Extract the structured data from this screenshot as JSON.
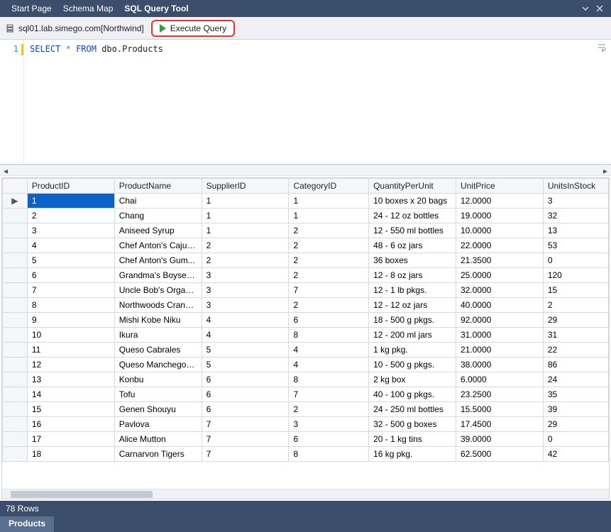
{
  "tabs": {
    "items": [
      "Start Page",
      "Schema Map",
      "SQL Query Tool"
    ],
    "active_index": 2
  },
  "toolbar": {
    "connection": "sql01.lab.simego.com[Northwind]",
    "execute_label": "Execute Query"
  },
  "editor": {
    "line_number": "1",
    "sql_select": "SELECT",
    "sql_star": "*",
    "sql_from": "FROM",
    "sql_ident": "dbo.Products"
  },
  "grid": {
    "columns": [
      "ProductID",
      "ProductName",
      "SupplierID",
      "CategoryID",
      "QuantityPerUnit",
      "UnitPrice",
      "UnitsInStock"
    ],
    "selected_row": 0,
    "rows": [
      {
        "ProductID": "1",
        "ProductName": "Chai",
        "SupplierID": "1",
        "CategoryID": "1",
        "QuantityPerUnit": "10 boxes x 20 bags",
        "UnitPrice": "12.0000",
        "UnitsInStock": "3"
      },
      {
        "ProductID": "2",
        "ProductName": "Chang",
        "SupplierID": "1",
        "CategoryID": "1",
        "QuantityPerUnit": "24 - 12 oz bottles",
        "UnitPrice": "19.0000",
        "UnitsInStock": "32"
      },
      {
        "ProductID": "3",
        "ProductName": "Aniseed Syrup",
        "SupplierID": "1",
        "CategoryID": "2",
        "QuantityPerUnit": "12 - 550 ml bottles",
        "UnitPrice": "10.0000",
        "UnitsInStock": "13"
      },
      {
        "ProductID": "4",
        "ProductName": "Chef Anton's Cajun...",
        "SupplierID": "2",
        "CategoryID": "2",
        "QuantityPerUnit": "48 - 6 oz jars",
        "UnitPrice": "22.0000",
        "UnitsInStock": "53"
      },
      {
        "ProductID": "5",
        "ProductName": "Chef Anton's Gum...",
        "SupplierID": "2",
        "CategoryID": "2",
        "QuantityPerUnit": "36 boxes",
        "UnitPrice": "21.3500",
        "UnitsInStock": "0"
      },
      {
        "ProductID": "6",
        "ProductName": "Grandma's Boysen...",
        "SupplierID": "3",
        "CategoryID": "2",
        "QuantityPerUnit": "12 - 8 oz jars",
        "UnitPrice": "25.0000",
        "UnitsInStock": "120"
      },
      {
        "ProductID": "7",
        "ProductName": "Uncle Bob's Organi...",
        "SupplierID": "3",
        "CategoryID": "7",
        "QuantityPerUnit": "12 - 1 lb pkgs.",
        "UnitPrice": "32.0000",
        "UnitsInStock": "15"
      },
      {
        "ProductID": "8",
        "ProductName": "Northwoods Cranb...",
        "SupplierID": "3",
        "CategoryID": "2",
        "QuantityPerUnit": "12 - 12 oz jars",
        "UnitPrice": "40.0000",
        "UnitsInStock": "2"
      },
      {
        "ProductID": "9",
        "ProductName": "Mishi Kobe Niku",
        "SupplierID": "4",
        "CategoryID": "6",
        "QuantityPerUnit": "18 - 500 g pkgs.",
        "UnitPrice": "92.0000",
        "UnitsInStock": "29"
      },
      {
        "ProductID": "10",
        "ProductName": "Ikura",
        "SupplierID": "4",
        "CategoryID": "8",
        "QuantityPerUnit": "12 - 200 ml jars",
        "UnitPrice": "31.0000",
        "UnitsInStock": "31"
      },
      {
        "ProductID": "11",
        "ProductName": "Queso Cabrales",
        "SupplierID": "5",
        "CategoryID": "4",
        "QuantityPerUnit": "1 kg pkg.",
        "UnitPrice": "21.0000",
        "UnitsInStock": "22"
      },
      {
        "ProductID": "12",
        "ProductName": "Queso Manchego L...",
        "SupplierID": "5",
        "CategoryID": "4",
        "QuantityPerUnit": "10 - 500 g pkgs.",
        "UnitPrice": "38.0000",
        "UnitsInStock": "86"
      },
      {
        "ProductID": "13",
        "ProductName": "Konbu",
        "SupplierID": "6",
        "CategoryID": "8",
        "QuantityPerUnit": "2 kg box",
        "UnitPrice": "6.0000",
        "UnitsInStock": "24"
      },
      {
        "ProductID": "14",
        "ProductName": "Tofu",
        "SupplierID": "6",
        "CategoryID": "7",
        "QuantityPerUnit": "40 - 100 g pkgs.",
        "UnitPrice": "23.2500",
        "UnitsInStock": "35"
      },
      {
        "ProductID": "15",
        "ProductName": "Genen Shouyu",
        "SupplierID": "6",
        "CategoryID": "2",
        "QuantityPerUnit": "24 - 250 ml bottles",
        "UnitPrice": "15.5000",
        "UnitsInStock": "39"
      },
      {
        "ProductID": "16",
        "ProductName": "Pavlova",
        "SupplierID": "7",
        "CategoryID": "3",
        "QuantityPerUnit": "32 - 500 g boxes",
        "UnitPrice": "17.4500",
        "UnitsInStock": "29"
      },
      {
        "ProductID": "17",
        "ProductName": "Alice Mutton",
        "SupplierID": "7",
        "CategoryID": "6",
        "QuantityPerUnit": "20 - 1 kg tins",
        "UnitPrice": "39.0000",
        "UnitsInStock": "0"
      },
      {
        "ProductID": "18",
        "ProductName": "Carnarvon Tigers",
        "SupplierID": "7",
        "CategoryID": "8",
        "QuantityPerUnit": "16 kg pkg.",
        "UnitPrice": "62.5000",
        "UnitsInStock": "42"
      }
    ]
  },
  "status": {
    "rowcount": "78 Rows"
  },
  "bottom_tabs": {
    "items": [
      "Products"
    ]
  }
}
